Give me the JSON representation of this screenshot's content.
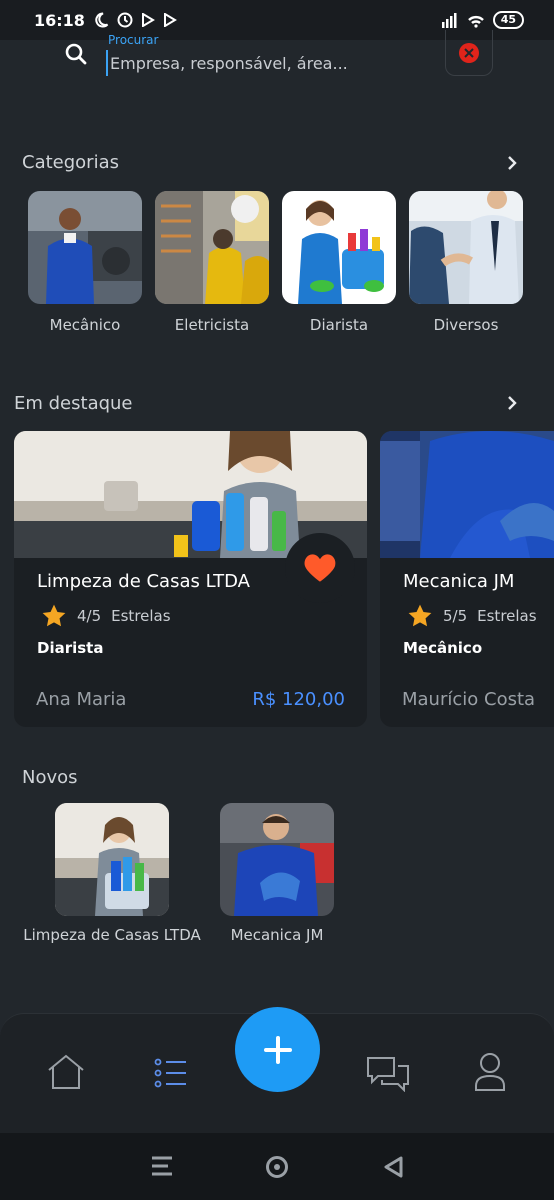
{
  "status_bar": {
    "time": "16:18",
    "battery": "45"
  },
  "search": {
    "label": "Procurar",
    "placeholder": "Empresa, responsável, área..."
  },
  "categories": {
    "title": "Categorias",
    "items": [
      {
        "label": "Mecânico",
        "icon": "mechanic-photo"
      },
      {
        "label": "Eletricista",
        "icon": "electrician-photo"
      },
      {
        "label": "Diarista",
        "icon": "cleaner-photo"
      },
      {
        "label": "Diversos",
        "icon": "handshake-photo"
      }
    ]
  },
  "featured": {
    "title": "Em destaque",
    "cards": [
      {
        "title": "Limpeza de Casas LTDA",
        "rating": "4/5",
        "rating_label": "Estrelas",
        "category": "Diarista",
        "owner": "Ana Maria",
        "price": "R$ 120,00",
        "favorited": true
      },
      {
        "title": "Mecanica JM",
        "rating": "5/5",
        "rating_label": "Estrelas",
        "category": "Mecânico",
        "owner": "Maurício Costa",
        "price": ""
      }
    ]
  },
  "new": {
    "title": "Novos",
    "items": [
      {
        "label": "Limpeza de Casas LTDA"
      },
      {
        "label": "Mecanica JM"
      }
    ]
  },
  "bottom_nav": {
    "items": [
      {
        "icon": "home-icon"
      },
      {
        "icon": "list-icon",
        "active": true
      },
      {
        "icon": "add-icon"
      },
      {
        "icon": "chat-icon"
      },
      {
        "icon": "profile-icon"
      }
    ]
  },
  "colors": {
    "accent": "#1e9bf5",
    "price": "#4a90ff",
    "heart": "#ff5a2a",
    "star": "#f5a623",
    "background": "#22272c"
  }
}
